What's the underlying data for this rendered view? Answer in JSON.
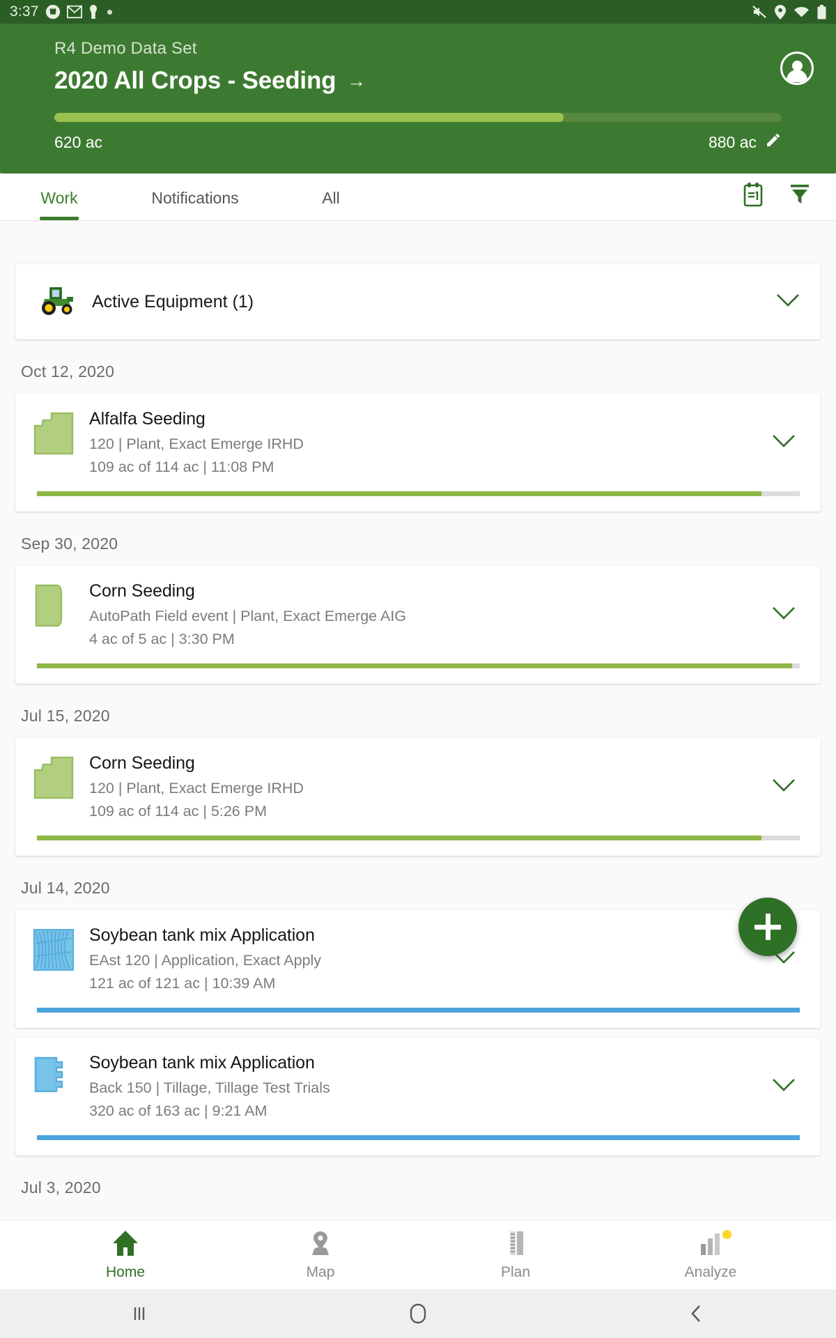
{
  "status_bar": {
    "clock": "3:37",
    "left_icons": [
      "deer-logo-icon",
      "gmail-icon",
      "app-icon",
      "notification-dot-icon"
    ],
    "right_icons": [
      "mute-icon",
      "location-pin-icon",
      "wifi-icon",
      "battery-icon"
    ]
  },
  "header": {
    "org": "R4 Demo Data Set",
    "title": "2020 All Crops - Seeding",
    "arrow": "→",
    "progress_current": "620 ac",
    "progress_total": "880 ac",
    "progress_percent": 70,
    "bar_color": "#9ac24f",
    "bg_color": "#3d7a31",
    "edit_icon": "pencil-icon",
    "avatar_icon": "user-avatar-icon"
  },
  "tabs": {
    "items": [
      {
        "label": "Work",
        "active": true
      },
      {
        "label": "Notifications",
        "active": false
      },
      {
        "label": "All",
        "active": false
      }
    ],
    "actions": [
      {
        "name": "work-plan-icon"
      },
      {
        "name": "filter-icon"
      }
    ]
  },
  "equipment_card": {
    "label": "Active Equipment (1)",
    "icon": "tractor-icon",
    "chevron": "chevron-down-icon"
  },
  "feed": [
    {
      "date": "Oct 12, 2020",
      "items": [
        {
          "title": "Alfalfa Seeding",
          "subtitle": "120 | Plant, Exact Emerge IRHD",
          "detail": "109 ac of 114 ac | 11:08 PM",
          "progress_percent": 95,
          "accent": "#8fb748",
          "thumb": "field-shape-l-green",
          "thumb_color": "#b2cf7f"
        }
      ]
    },
    {
      "date": "Sep 30, 2020",
      "items": [
        {
          "title": "Corn Seeding",
          "subtitle": "AutoPath Field event | Plant, Exact Emerge AIG",
          "detail": "4 ac of 5 ac | 3:30 PM",
          "progress_percent": 99,
          "accent": "#8fb748",
          "thumb": "field-shape-leaf-green",
          "thumb_color": "#b2cf7f"
        }
      ]
    },
    {
      "date": "Jul 15, 2020",
      "items": [
        {
          "title": "Corn Seeding",
          "subtitle": "120 | Plant, Exact Emerge IRHD",
          "detail": "109 ac of 114 ac | 5:26 PM",
          "progress_percent": 95,
          "accent": "#8fb748",
          "thumb": "field-shape-l-green",
          "thumb_color": "#b2cf7f"
        }
      ]
    },
    {
      "date": "Jul 14, 2020",
      "items": [
        {
          "title": "Soybean tank mix Application",
          "subtitle": "EAst 120 | Application, Exact Apply",
          "detail": "121 ac of 121 ac | 10:39 AM",
          "progress_percent": 100,
          "accent": "#4aa3dd",
          "thumb": "field-shape-coverage-blue",
          "thumb_color": "#77c3ea"
        },
        {
          "title": "Soybean tank mix Application",
          "subtitle": "Back 150 | Tillage, Tillage Test Trials",
          "detail": "320 ac of 163 ac | 9:21 AM",
          "progress_percent": 100,
          "accent": "#4aa3dd",
          "thumb": "field-shape-notched-blue",
          "thumb_color": "#77c3ea"
        }
      ]
    },
    {
      "date": "Jul 3, 2020",
      "items": []
    }
  ],
  "fab": {
    "label": "+",
    "name": "add-button",
    "color": "#2e7025"
  },
  "bottom_nav": [
    {
      "label": "Home",
      "icon": "home-icon",
      "active": true,
      "badge": false
    },
    {
      "label": "Map",
      "icon": "map-pin-icon",
      "active": false,
      "badge": false
    },
    {
      "label": "Plan",
      "icon": "plan-icon",
      "active": false,
      "badge": false
    },
    {
      "label": "Analyze",
      "icon": "analyze-bars-icon",
      "active": false,
      "badge": true
    }
  ],
  "system_nav": [
    {
      "name": "recents-button",
      "glyph": "⦀"
    },
    {
      "name": "home-button",
      "glyph": "◯"
    },
    {
      "name": "back-button",
      "glyph": "‹"
    }
  ]
}
